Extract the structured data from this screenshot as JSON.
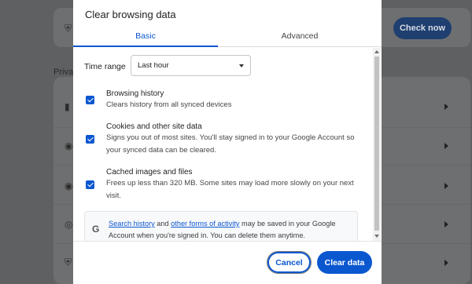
{
  "background": {
    "section_label": "Priva",
    "check_now_label": "Check now"
  },
  "dialog": {
    "title": "Clear browsing data",
    "tabs": [
      {
        "label": "Basic",
        "selected": true
      },
      {
        "label": "Advanced",
        "selected": false
      }
    ],
    "time_range": {
      "label": "Time range",
      "selected": "Last hour"
    },
    "options": [
      {
        "title": "Browsing history",
        "description": "Clears history from all synced devices",
        "checked": true
      },
      {
        "title": "Cookies and other site data",
        "description": "Signs you out of most sites. You'll stay signed in to your Google Account so your synced data can be cleared.",
        "checked": true
      },
      {
        "title": "Cached images and files",
        "description": "Frees up less than 320 MB. Some sites may load more slowly on your next visit.",
        "checked": true
      }
    ],
    "info": {
      "link1": "Search history",
      "text1": " and ",
      "link2": "other forms of activity",
      "text2": " may be saved in your Google Account when you're signed in. You can delete them anytime."
    },
    "buttons": {
      "cancel": "Cancel",
      "clear": "Clear data"
    }
  },
  "colors": {
    "accent": "#0b57d0",
    "overlay": "#5f6062"
  }
}
